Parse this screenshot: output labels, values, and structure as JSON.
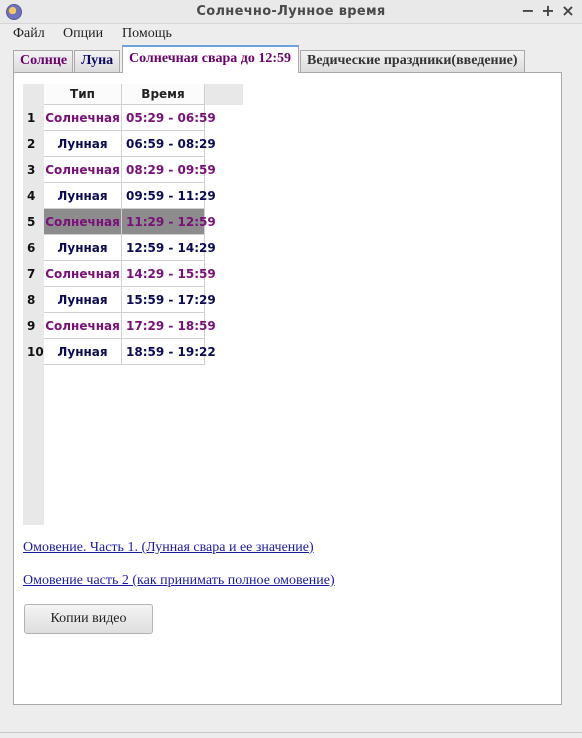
{
  "window": {
    "title": "Солнечно-Лунное время",
    "minimize": "−",
    "maximize": "+",
    "close": "×"
  },
  "menu": [
    "Файл",
    "Опции",
    "Помощь"
  ],
  "tabs": [
    {
      "label": "Солнце",
      "color": "#6a006a"
    },
    {
      "label": "Луна",
      "color": "#0a0a6a"
    },
    {
      "label": "Солнечная свара до 12:59",
      "color": "#6a006a"
    },
    {
      "label": "Ведические праздники(введение)",
      "color": "#333333"
    }
  ],
  "active_tab": 2,
  "table": {
    "headers": [
      "Тип",
      "Время"
    ],
    "selected_row": 5,
    "colors": {
      "solar": "#7a0e7a",
      "lunar": "#0b0b55"
    },
    "rows": [
      {
        "n": "1",
        "type": "Солнечная",
        "time": "05:29 - 06:59",
        "kind": "solar"
      },
      {
        "n": "2",
        "type": "Лунная",
        "time": "06:59 - 08:29",
        "kind": "lunar"
      },
      {
        "n": "3",
        "type": "Солнечная",
        "time": "08:29 - 09:59",
        "kind": "solar"
      },
      {
        "n": "4",
        "type": "Лунная",
        "time": "09:59 - 11:29",
        "kind": "lunar"
      },
      {
        "n": "5",
        "type": "Солнечная",
        "time": "11:29 - 12:59",
        "kind": "solar"
      },
      {
        "n": "6",
        "type": "Лунная",
        "time": "12:59 - 14:29",
        "kind": "lunar"
      },
      {
        "n": "7",
        "type": "Солнечная",
        "time": "14:29 - 15:59",
        "kind": "solar"
      },
      {
        "n": "8",
        "type": "Лунная",
        "time": "15:59 - 17:29",
        "kind": "lunar"
      },
      {
        "n": "9",
        "type": "Солнечная",
        "time": "17:29 - 18:59",
        "kind": "solar"
      },
      {
        "n": "10",
        "type": "Лунная",
        "time": "18:59 - 19:22",
        "kind": "lunar"
      }
    ]
  },
  "links": [
    {
      "label": "Омовение. Часть 1. (Лунная свара и ее значение)"
    },
    {
      "label": "Омовение часть 2 (как принимать полное омовение)"
    }
  ],
  "link_color": "#1a1aa6",
  "button_label": "Копии видео"
}
